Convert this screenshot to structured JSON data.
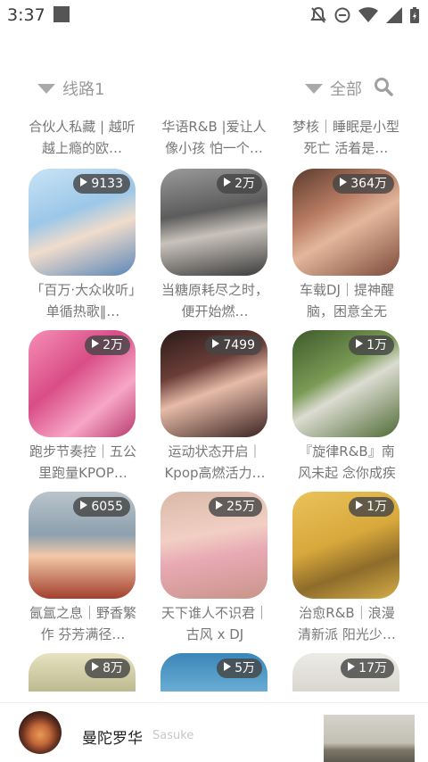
{
  "status_bar": {
    "time": "3:37"
  },
  "filters": {
    "line_label": "线路1",
    "category_label": "全部"
  },
  "grid": {
    "top_titles": [
      "合伙人私藏 | 越听越上瘾的欧…",
      "华语R&B |爱让人像小孩 怕一个…",
      "梦核｜睡眠是小型死亡 活着是…"
    ],
    "items": [
      {
        "count": "9133",
        "title": "「百万·大众收听」单循热歌‖…"
      },
      {
        "count": "2万",
        "title": "当糖原耗尽之时，便开始燃…"
      },
      {
        "count": "364万",
        "title": "车载DJ｜提神醒脑，困意全无"
      },
      {
        "count": "2万",
        "title": "跑步节奏控｜五公里跑量KPOP…"
      },
      {
        "count": "7499",
        "title": "运动状态开启｜Kpop高燃活力…"
      },
      {
        "count": "1万",
        "title": "『旋律R&B』南风未起 念你成疾"
      },
      {
        "count": "6055",
        "title": "氤氲之息｜野香繁作 芬芳满径…"
      },
      {
        "count": "25万",
        "title": "天下谁人不识君｜古风 x DJ"
      },
      {
        "count": "1万",
        "title": "治愈R&B｜浪漫清新派 阳光少…"
      },
      {
        "count": "8万",
        "title": ""
      },
      {
        "count": "5万",
        "title": ""
      },
      {
        "count": "17万",
        "title": ""
      }
    ]
  },
  "player": {
    "song": "曼陀罗华",
    "artist": "Sasuke"
  }
}
